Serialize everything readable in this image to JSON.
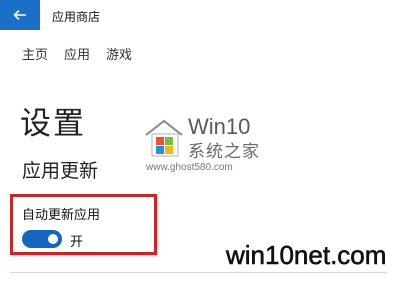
{
  "window": {
    "title": "应用商店",
    "back_icon": "back-arrow-icon"
  },
  "nav": {
    "items": [
      "主页",
      "应用",
      "游戏"
    ]
  },
  "settings": {
    "title": "设置",
    "section_title": "应用更新",
    "auto_update": {
      "label": "自动更新应用",
      "state_label": "开",
      "on": true
    }
  },
  "watermarks": {
    "brand": "Win10",
    "brand_cn": "系统之家",
    "url": "www.ghost580.com",
    "site": "win10net.com"
  },
  "colors": {
    "accent": "#1a6fc9",
    "toggle_on": "#1666c0",
    "highlight": "#c0282c",
    "logo_colors": [
      "#e8542a",
      "#7dbb3e",
      "#2a8fd6",
      "#f2b71e"
    ]
  }
}
